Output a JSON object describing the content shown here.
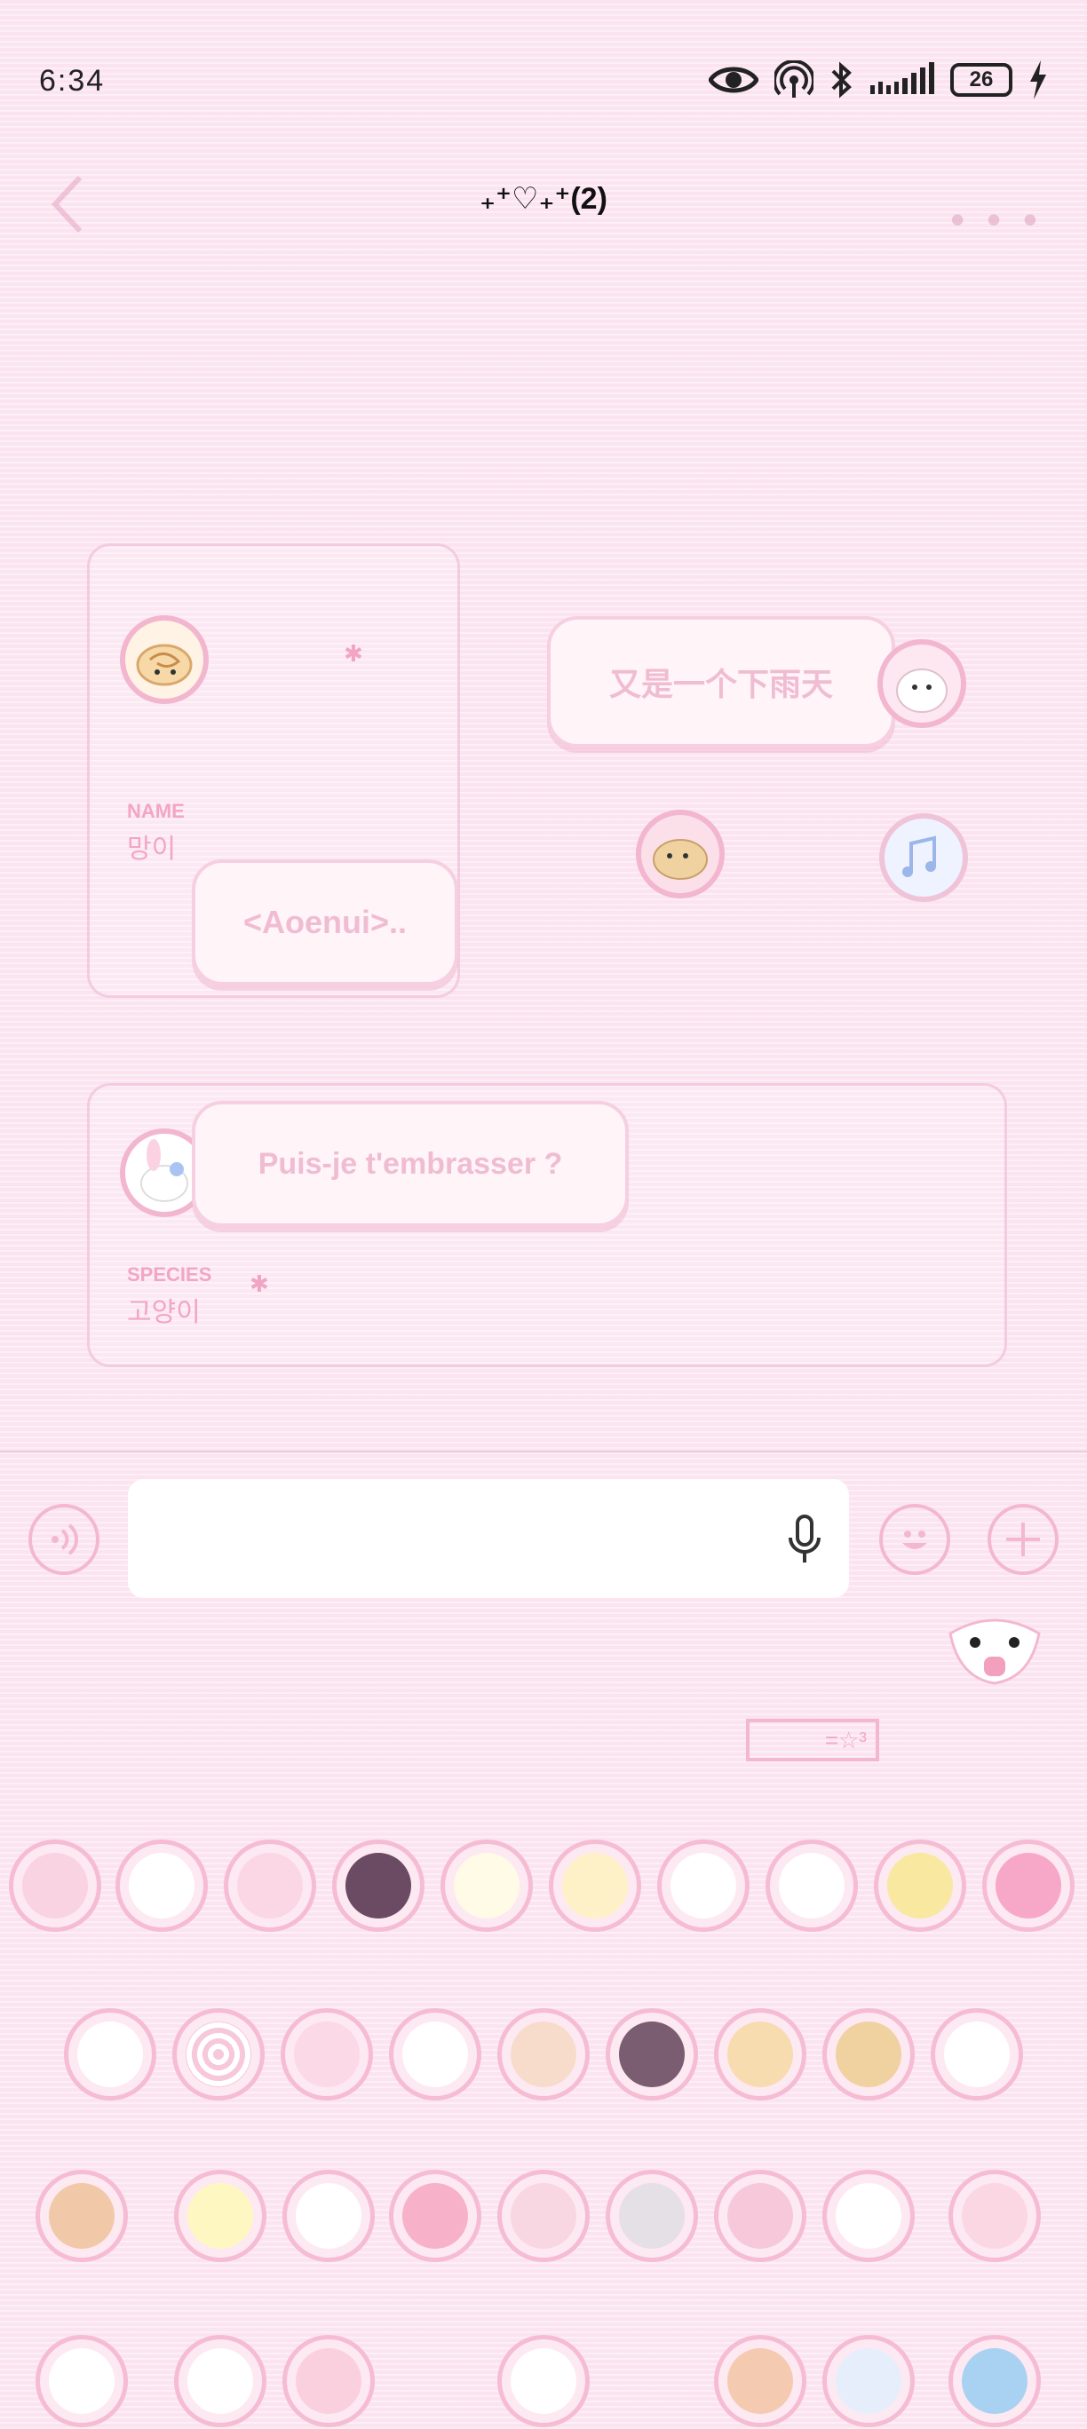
{
  "status_bar": {
    "time": "6:34",
    "battery": "26",
    "icons": [
      "eye-icon",
      "hotspot-icon",
      "bluetooth-icon",
      "signal-icon",
      "battery-icon",
      "charging-icon"
    ]
  },
  "header": {
    "title": "₊⁺♡₊⁺(2)",
    "back_icon": "chevron-left-icon",
    "more_icon": "more-icon"
  },
  "chat": {
    "card1": {
      "name_label": "NAME",
      "name_value": "망이",
      "bubble_text": "<Aoenui>.."
    },
    "bubble_right": "又是一个下雨天",
    "card2": {
      "species_label": "SPECIES",
      "species_value": "고양이",
      "bubble_text": "Puis-je t'embrasser ?"
    }
  },
  "input_bar": {
    "placeholder": "",
    "icons": [
      "voice-icon",
      "mic-icon",
      "emoji-icon",
      "plus-icon"
    ]
  },
  "sticker_panel": {
    "tag_text": "=☆³",
    "colors": {
      "accent": "#f3b6cf",
      "bubble_text": "#f0bcd1",
      "background": "#fbe6f1"
    }
  }
}
